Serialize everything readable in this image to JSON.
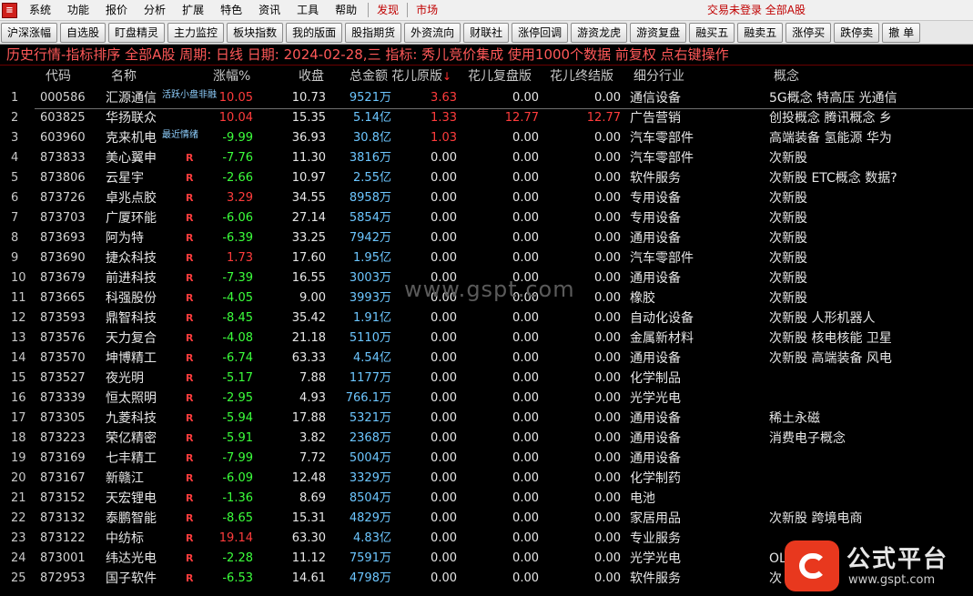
{
  "menubar": {
    "items": [
      "系统",
      "功能",
      "报价",
      "分析",
      "扩展",
      "特色",
      "资讯",
      "工具",
      "帮助"
    ],
    "highlight": [
      "发现",
      "市场"
    ],
    "status": "交易未登录  全部A股"
  },
  "toolbar": {
    "buttons": [
      "沪深涨幅",
      "自选股",
      "盯盘精灵",
      "主力监控",
      "板块指数",
      "我的版面",
      "股指期货",
      "外资流向",
      "财联社",
      "涨停回调",
      "游资龙虎",
      "游资复盘",
      "融买五",
      "融卖五",
      "涨停买",
      "跌停卖",
      "撤 单"
    ]
  },
  "title": "历史行情-指标排序 全部A股 周期: 日线 日期: 2024-02-28,三 指标: 秀儿竞价集成 使用1000个数据 前复权 点右键操作",
  "columns": {
    "code": "代码",
    "name": "名称",
    "chg": "涨幅%",
    "close": "收盘",
    "amount": "总金额",
    "v1": "花儿原版",
    "v1_arrow": "↓",
    "v2": "花儿复盘版",
    "v3": "花儿终结版",
    "industry": "细分行业",
    "concept": "概念"
  },
  "rows": [
    {
      "idx": "1",
      "code": "000586",
      "name": "汇源通信",
      "r": "",
      "chg": "10.05",
      "dir": "up",
      "close": "10.73",
      "amt": "9521",
      "unit": "万",
      "v1": "3.63",
      "v1c": "up",
      "v2": "0.00",
      "v2c": "white",
      "v3": "0.00",
      "v3c": "white",
      "ind": "通信设备",
      "con": "5G概念 特高压 光通信"
    },
    {
      "idx": "2",
      "code": "603825",
      "name": "华扬联众",
      "r": "",
      "chg": "10.04",
      "dir": "up",
      "close": "15.35",
      "amt": "5.14",
      "unit": "亿",
      "v1": "1.33",
      "v1c": "up",
      "v2": "12.77",
      "v2c": "up",
      "v3": "12.77",
      "v3c": "up",
      "ind": "广告营销",
      "con": "创投概念 腾讯概念 乡"
    },
    {
      "idx": "3",
      "code": "603960",
      "name": "克来机电",
      "r": "",
      "chg": "-9.99",
      "dir": "down",
      "close": "36.93",
      "amt": "30.8",
      "unit": "亿",
      "v1": "1.03",
      "v1c": "up",
      "v2": "0.00",
      "v2c": "white",
      "v3": "0.00",
      "v3c": "white",
      "ind": "汽车零部件",
      "con": "高端装备 氢能源 华为"
    },
    {
      "idx": "4",
      "code": "873833",
      "name": "美心翼申",
      "r": "R",
      "chg": "-7.76",
      "dir": "down",
      "close": "11.30",
      "amt": "3816",
      "unit": "万",
      "v1": "0.00",
      "v1c": "white",
      "v2": "0.00",
      "v2c": "white",
      "v3": "0.00",
      "v3c": "white",
      "ind": "汽车零部件",
      "con": "次新股"
    },
    {
      "idx": "5",
      "code": "873806",
      "name": "云星宇",
      "r": "R",
      "chg": "-2.66",
      "dir": "down",
      "close": "10.97",
      "amt": "2.55",
      "unit": "亿",
      "v1": "0.00",
      "v1c": "white",
      "v2": "0.00",
      "v2c": "white",
      "v3": "0.00",
      "v3c": "white",
      "ind": "软件服务",
      "con": "次新股 ETC概念 数据?"
    },
    {
      "idx": "6",
      "code": "873726",
      "name": "卓兆点胶",
      "r": "R",
      "chg": "3.29",
      "dir": "up",
      "close": "34.55",
      "amt": "8958",
      "unit": "万",
      "v1": "0.00",
      "v1c": "white",
      "v2": "0.00",
      "v2c": "white",
      "v3": "0.00",
      "v3c": "white",
      "ind": "专用设备",
      "con": "次新股"
    },
    {
      "idx": "7",
      "code": "873703",
      "name": "广厦环能",
      "r": "R",
      "chg": "-6.06",
      "dir": "down",
      "close": "27.14",
      "amt": "5854",
      "unit": "万",
      "v1": "0.00",
      "v1c": "white",
      "v2": "0.00",
      "v2c": "white",
      "v3": "0.00",
      "v3c": "white",
      "ind": "专用设备",
      "con": "次新股"
    },
    {
      "idx": "8",
      "code": "873693",
      "name": "阿为特",
      "r": "R",
      "chg": "-6.39",
      "dir": "down",
      "close": "33.25",
      "amt": "7942",
      "unit": "万",
      "v1": "0.00",
      "v1c": "white",
      "v2": "0.00",
      "v2c": "white",
      "v3": "0.00",
      "v3c": "white",
      "ind": "通用设备",
      "con": "次新股"
    },
    {
      "idx": "9",
      "code": "873690",
      "name": "捷众科技",
      "r": "R",
      "chg": "1.73",
      "dir": "up",
      "close": "17.60",
      "amt": "1.95",
      "unit": "亿",
      "v1": "0.00",
      "v1c": "white",
      "v2": "0.00",
      "v2c": "white",
      "v3": "0.00",
      "v3c": "white",
      "ind": "汽车零部件",
      "con": "次新股"
    },
    {
      "idx": "10",
      "code": "873679",
      "name": "前进科技",
      "r": "R",
      "chg": "-7.39",
      "dir": "down",
      "close": "16.55",
      "amt": "3003",
      "unit": "万",
      "v1": "0.00",
      "v1c": "white",
      "v2": "0.00",
      "v2c": "white",
      "v3": "0.00",
      "v3c": "white",
      "ind": "通用设备",
      "con": "次新股"
    },
    {
      "idx": "11",
      "code": "873665",
      "name": "科强股份",
      "r": "R",
      "chg": "-4.05",
      "dir": "down",
      "close": "9.00",
      "amt": "3993",
      "unit": "万",
      "v1": "0.00",
      "v1c": "white",
      "v2": "0.00",
      "v2c": "white",
      "v3": "0.00",
      "v3c": "white",
      "ind": "橡胶",
      "con": "次新股"
    },
    {
      "idx": "12",
      "code": "873593",
      "name": "鼎智科技",
      "r": "R",
      "chg": "-8.45",
      "dir": "down",
      "close": "35.42",
      "amt": "1.91",
      "unit": "亿",
      "v1": "0.00",
      "v1c": "white",
      "v2": "0.00",
      "v2c": "white",
      "v3": "0.00",
      "v3c": "white",
      "ind": "自动化设备",
      "con": "次新股 人形机器人"
    },
    {
      "idx": "13",
      "code": "873576",
      "name": "天力复合",
      "r": "R",
      "chg": "-4.08",
      "dir": "down",
      "close": "21.18",
      "amt": "5110",
      "unit": "万",
      "v1": "0.00",
      "v1c": "white",
      "v2": "0.00",
      "v2c": "white",
      "v3": "0.00",
      "v3c": "white",
      "ind": "金属新材料",
      "con": "次新股 核电核能 卫星"
    },
    {
      "idx": "14",
      "code": "873570",
      "name": "坤博精工",
      "r": "R",
      "chg": "-6.74",
      "dir": "down",
      "close": "63.33",
      "amt": "4.54",
      "unit": "亿",
      "v1": "0.00",
      "v1c": "white",
      "v2": "0.00",
      "v2c": "white",
      "v3": "0.00",
      "v3c": "white",
      "ind": "通用设备",
      "con": "次新股 高端装备 风电"
    },
    {
      "idx": "15",
      "code": "873527",
      "name": "夜光明",
      "r": "R",
      "chg": "-5.17",
      "dir": "down",
      "close": "7.88",
      "amt": "1177",
      "unit": "万",
      "v1": "0.00",
      "v1c": "white",
      "v2": "0.00",
      "v2c": "white",
      "v3": "0.00",
      "v3c": "white",
      "ind": "化学制品",
      "con": ""
    },
    {
      "idx": "16",
      "code": "873339",
      "name": "恒太照明",
      "r": "R",
      "chg": "-2.95",
      "dir": "down",
      "close": "4.93",
      "amt": "766.1",
      "unit": "万",
      "v1": "0.00",
      "v1c": "white",
      "v2": "0.00",
      "v2c": "white",
      "v3": "0.00",
      "v3c": "white",
      "ind": "光学光电",
      "con": ""
    },
    {
      "idx": "17",
      "code": "873305",
      "name": "九菱科技",
      "r": "R",
      "chg": "-5.94",
      "dir": "down",
      "close": "17.88",
      "amt": "5321",
      "unit": "万",
      "v1": "0.00",
      "v1c": "white",
      "v2": "0.00",
      "v2c": "white",
      "v3": "0.00",
      "v3c": "white",
      "ind": "通用设备",
      "con": "稀土永磁"
    },
    {
      "idx": "18",
      "code": "873223",
      "name": "荣亿精密",
      "r": "R",
      "chg": "-5.91",
      "dir": "down",
      "close": "3.82",
      "amt": "2368",
      "unit": "万",
      "v1": "0.00",
      "v1c": "white",
      "v2": "0.00",
      "v2c": "white",
      "v3": "0.00",
      "v3c": "white",
      "ind": "通用设备",
      "con": "消费电子概念"
    },
    {
      "idx": "19",
      "code": "873169",
      "name": "七丰精工",
      "r": "R",
      "chg": "-7.99",
      "dir": "down",
      "close": "7.72",
      "amt": "5004",
      "unit": "万",
      "v1": "0.00",
      "v1c": "white",
      "v2": "0.00",
      "v2c": "white",
      "v3": "0.00",
      "v3c": "white",
      "ind": "通用设备",
      "con": ""
    },
    {
      "idx": "20",
      "code": "873167",
      "name": "新赣江",
      "r": "R",
      "chg": "-6.09",
      "dir": "down",
      "close": "12.48",
      "amt": "3329",
      "unit": "万",
      "v1": "0.00",
      "v1c": "white",
      "v2": "0.00",
      "v2c": "white",
      "v3": "0.00",
      "v3c": "white",
      "ind": "化学制药",
      "con": ""
    },
    {
      "idx": "21",
      "code": "873152",
      "name": "天宏锂电",
      "r": "R",
      "chg": "-1.36",
      "dir": "down",
      "close": "8.69",
      "amt": "8504",
      "unit": "万",
      "v1": "0.00",
      "v1c": "white",
      "v2": "0.00",
      "v2c": "white",
      "v3": "0.00",
      "v3c": "white",
      "ind": "电池",
      "con": ""
    },
    {
      "idx": "22",
      "code": "873132",
      "name": "泰鹏智能",
      "r": "R",
      "chg": "-8.65",
      "dir": "down",
      "close": "15.31",
      "amt": "4829",
      "unit": "万",
      "v1": "0.00",
      "v1c": "white",
      "v2": "0.00",
      "v2c": "white",
      "v3": "0.00",
      "v3c": "white",
      "ind": "家居用品",
      "con": "次新股 跨境电商"
    },
    {
      "idx": "23",
      "code": "873122",
      "name": "中纺标",
      "r": "R",
      "chg": "19.14",
      "dir": "up",
      "close": "63.30",
      "amt": "4.83",
      "unit": "亿",
      "v1": "0.00",
      "v1c": "white",
      "v2": "0.00",
      "v2c": "white",
      "v3": "0.00",
      "v3c": "white",
      "ind": "专业服务",
      "con": ""
    },
    {
      "idx": "24",
      "code": "873001",
      "name": "纬达光电",
      "r": "R",
      "chg": "-2.28",
      "dir": "down",
      "close": "11.12",
      "amt": "7591",
      "unit": "万",
      "v1": "0.00",
      "v1c": "white",
      "v2": "0.00",
      "v2c": "white",
      "v3": "0.00",
      "v3c": "white",
      "ind": "光学光电",
      "con": "OL"
    },
    {
      "idx": "25",
      "code": "872953",
      "name": "国子软件",
      "r": "R",
      "chg": "-6.53",
      "dir": "down",
      "close": "14.61",
      "amt": "4798",
      "unit": "万",
      "v1": "0.00",
      "v1c": "white",
      "v2": "0.00",
      "v2c": "white",
      "v3": "0.00",
      "v3c": "white",
      "ind": "软件服务",
      "con": "次"
    }
  ],
  "tags": {
    "row1": "活跃小盘非融",
    "row3": "最近情绪"
  },
  "watermark": "www.gspt.com",
  "logo": {
    "name": "公式平台",
    "url": "www.gspt.com"
  },
  "colors": {
    "up": "#ff3c3c",
    "down": "#3cff3c",
    "amount": "#6cc6ff",
    "title": "#ff5858",
    "background": "#000000"
  }
}
